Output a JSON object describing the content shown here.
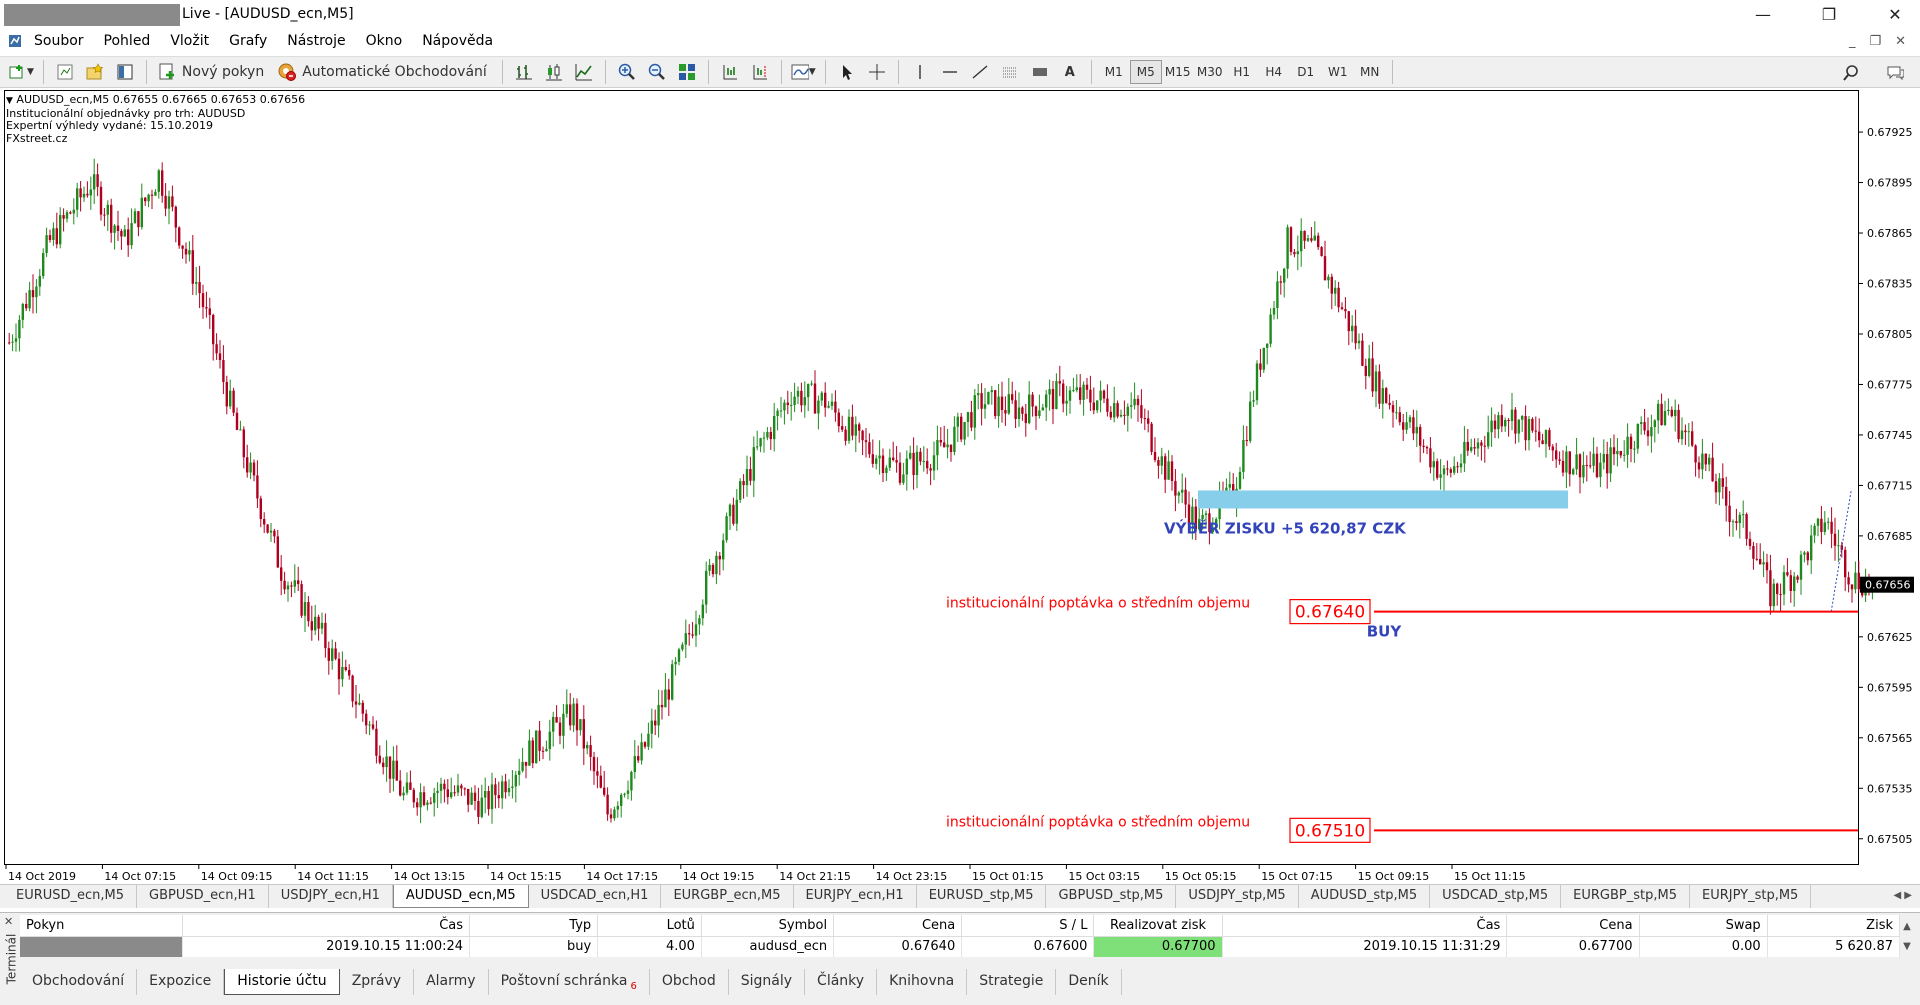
{
  "window": {
    "title": "Live - [AUDUSD_ecn,M5]",
    "minimize": "—",
    "restore": "❐",
    "close": "✕"
  },
  "menu": [
    "Soubor",
    "Pohled",
    "Vložit",
    "Grafy",
    "Nástroje",
    "Okno",
    "Nápověda"
  ],
  "toolbar": {
    "new_order": "Nový pokyn",
    "auto_trading": "Automatické Obchodování",
    "timeframes": [
      "M1",
      "M5",
      "M15",
      "M30",
      "H1",
      "H4",
      "D1",
      "W1",
      "MN"
    ],
    "active_timeframe": "M5"
  },
  "chart_info": {
    "line1": "AUDUSD_ecn,M5  0.67655 0.67665 0.67653 0.67656",
    "line2": "Institucionální objednávky pro trh: AUDUSD",
    "line3": "Expertní výhledy vydané: 15.10.2019",
    "line4": "FXstreet.cz"
  },
  "chart_data": {
    "type": "candlestick",
    "symbol": "AUDUSD_ecn",
    "timeframe": "M5",
    "ylim": [
      0.6749,
      0.6795
    ],
    "y_ticks": [
      "0.67925",
      "0.67895",
      "0.67865",
      "0.67835",
      "0.67805",
      "0.67775",
      "0.67745",
      "0.67715",
      "0.67685",
      "0.67656",
      "0.67625",
      "0.67595",
      "0.67565",
      "0.67535",
      "0.67505"
    ],
    "y_tick_values": [
      0.67925,
      0.67895,
      0.67865,
      0.67835,
      0.67805,
      0.67775,
      0.67745,
      0.67715,
      0.67685,
      0.67656,
      0.67625,
      0.67595,
      0.67565,
      0.67535,
      0.67505
    ],
    "current_price": "0.67656",
    "current_price_value": 0.67656,
    "x_ticks": [
      "14 Oct 2019",
      "14 Oct 07:15",
      "14 Oct 09:15",
      "14 Oct 11:15",
      "14 Oct 13:15",
      "14 Oct 15:15",
      "14 Oct 17:15",
      "14 Oct 19:15",
      "14 Oct 21:15",
      "14 Oct 23:15",
      "15 Oct 01:15",
      "15 Oct 03:15",
      "15 Oct 05:15",
      "15 Oct 07:15",
      "15 Oct 09:15",
      "15 Oct 11:15"
    ],
    "price_path": [
      [
        0,
        0.678
      ],
      [
        12,
        0.6786
      ],
      [
        24,
        0.67895
      ],
      [
        34,
        0.6786
      ],
      [
        44,
        0.679
      ],
      [
        56,
        0.6783
      ],
      [
        68,
        0.6774
      ],
      [
        80,
        0.67665
      ],
      [
        92,
        0.67625
      ],
      [
        104,
        0.6758
      ],
      [
        116,
        0.6753
      ],
      [
        128,
        0.67535
      ],
      [
        140,
        0.67525
      ],
      [
        152,
        0.67555
      ],
      [
        166,
        0.6758
      ],
      [
        176,
        0.6752
      ],
      [
        186,
        0.67555
      ],
      [
        198,
        0.67615
      ],
      [
        208,
        0.67675
      ],
      [
        220,
        0.67735
      ],
      [
        230,
        0.6777
      ],
      [
        240,
        0.67765
      ],
      [
        250,
        0.6774
      ],
      [
        262,
        0.67725
      ],
      [
        274,
        0.67735
      ],
      [
        286,
        0.67765
      ],
      [
        298,
        0.6776
      ],
      [
        310,
        0.6777
      ],
      [
        322,
        0.67765
      ],
      [
        332,
        0.6776
      ],
      [
        340,
        0.67725
      ],
      [
        350,
        0.6769
      ],
      [
        360,
        0.6771
      ],
      [
        368,
        0.6779
      ],
      [
        376,
        0.6786
      ],
      [
        384,
        0.67855
      ],
      [
        392,
        0.6782
      ],
      [
        402,
        0.67775
      ],
      [
        412,
        0.6775
      ],
      [
        422,
        0.6772
      ],
      [
        432,
        0.6774
      ],
      [
        440,
        0.6776
      ],
      [
        448,
        0.67745
      ],
      [
        458,
        0.6773
      ],
      [
        468,
        0.67725
      ],
      [
        478,
        0.67745
      ],
      [
        488,
        0.6776
      ],
      [
        498,
        0.6773
      ],
      [
        506,
        0.677
      ],
      [
        512,
        0.67685
      ],
      [
        518,
        0.6765
      ],
      [
        526,
        0.67665
      ],
      [
        534,
        0.67695
      ],
      [
        542,
        0.6766
      ],
      [
        548,
        0.67656
      ]
    ],
    "path_length": 548,
    "zones": [
      {
        "label": "VÝBĚR ZISKU +5 620,87 CZK",
        "price_low": 0.67703,
        "price_high": 0.67712,
        "color": "#87ceeb"
      }
    ],
    "levels": [
      {
        "price": 0.6764,
        "label": "0.67640",
        "annotation": "institucionální poptávka o středním objemu",
        "color": "#ff0000"
      },
      {
        "price": 0.6751,
        "label": "0.67510",
        "annotation": "institucionální poptávka o středním objemu",
        "color": "#ff0000"
      }
    ],
    "markers": [
      {
        "label": "BUY",
        "color": "#3344bb"
      }
    ],
    "colors": {
      "bull": "#1e8a1e",
      "bear": "#b00020",
      "background": "#ffffff",
      "current_price_box": "#000000"
    }
  },
  "symbol_tabs": [
    "EURUSD_ecn,M5",
    "GBPUSD_ecn,H1",
    "USDJPY_ecn,H1",
    "AUDUSD_ecn,M5",
    "USDCAD_ecn,H1",
    "EURGBP_ecn,M5",
    "EURJPY_ecn,H1",
    "EURUSD_stp,M5",
    "GBPUSD_stp,M5",
    "USDJPY_stp,M5",
    "AUDUSD_stp,M5",
    "USDCAD_stp,M5",
    "EURGBP_stp,M5",
    "EURJPY_stp,M5"
  ],
  "active_symbol_tab": "AUDUSD_ecn,M5",
  "terminal": {
    "label": "Terminál",
    "close": "✕",
    "headers": [
      "Pokyn",
      "Čas",
      "Typ",
      "Lotů",
      "Symbol",
      "Cena",
      "S / L",
      "Realizovat zisk",
      "Čas",
      "Cena",
      "Swap",
      "Zisk"
    ],
    "row": [
      "",
      "2019.10.15 11:00:24",
      "buy",
      "4.00",
      "audusd_ecn",
      "0.67640",
      "0.67600",
      "0.67700",
      "2019.10.15 11:31:29",
      "0.67700",
      "0.00",
      "5 620.87"
    ],
    "tabs": [
      "Obchodování",
      "Expozice",
      "Historie účtu",
      "Zprávy",
      "Alarmy",
      "Poštovní schránka",
      "Obchod",
      "Signály",
      "Články",
      "Knihovna",
      "Strategie",
      "Deník"
    ],
    "active_tab": "Historie účtu",
    "mailbox_badge": "6"
  }
}
